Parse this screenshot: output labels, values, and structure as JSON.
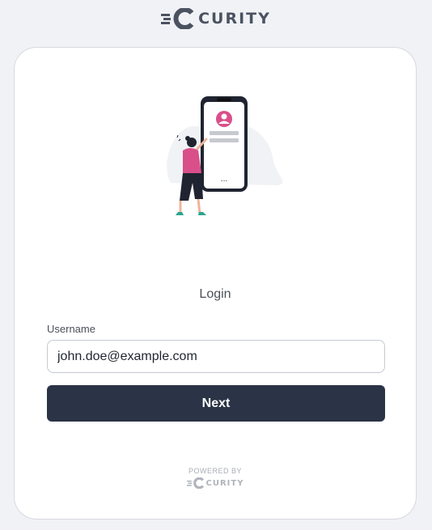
{
  "header": {
    "brand_name": "CURITY",
    "logo_icon": "curity-logo-icon"
  },
  "illustration": {
    "icon": "person-phone-illustration",
    "phone_dots": "..."
  },
  "login": {
    "title": "Login",
    "username_label": "Username",
    "username_value": "john.doe@example.com",
    "next_label": "Next"
  },
  "footer": {
    "powered_by": "POWERED BY",
    "brand_name": "CURITY"
  },
  "colors": {
    "background": "#f1f2f6",
    "primary": "#2b3446",
    "accent_pink": "#d94f8a",
    "accent_teal": "#2aa68f"
  }
}
